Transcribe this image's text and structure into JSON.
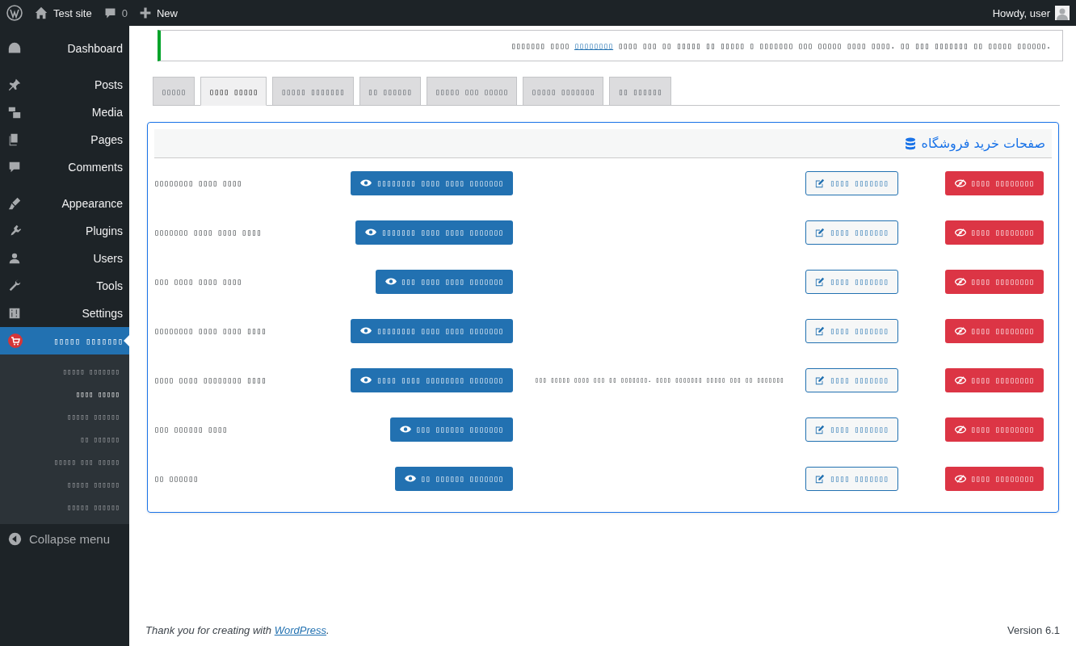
{
  "admin_bar": {
    "site": "Test site",
    "comments": "0",
    "new": "New",
    "greeting": "Howdy, user"
  },
  "sidebar": {
    "items": [
      {
        "label": "Dashboard",
        "selected": false
      },
      {
        "label": "Posts",
        "selected": false
      },
      {
        "label": "Media",
        "selected": false
      },
      {
        "label": "Pages",
        "selected": false
      },
      {
        "label": "Comments",
        "selected": false
      },
      {
        "label": "Appearance",
        "selected": false
      },
      {
        "label": "Plugins",
        "selected": false
      },
      {
        "label": "Users",
        "selected": false
      },
      {
        "label": "Tools",
        "selected": false
      },
      {
        "label": "Settings",
        "selected": false
      },
      {
        "label": "▯▯▯▯▯ ▯▯▯▯▯▯▯",
        "selected": true
      }
    ],
    "submenu": [
      {
        "label": "▯▯▯▯▯ ▯▯▯▯▯▯▯",
        "selected": false
      },
      {
        "label": "▯▯▯▯ ▯▯▯▯▯",
        "selected": true
      },
      {
        "label": "▯▯▯▯▯ ▯▯▯▯▯▯",
        "selected": false
      },
      {
        "label": "▯▯ ▯▯▯▯▯▯",
        "selected": false
      },
      {
        "label": "▯▯▯▯▯ ▯▯▯ ▯▯▯▯▯",
        "selected": false
      },
      {
        "label": "▯▯▯▯▯ ▯▯▯▯▯▯",
        "selected": false
      },
      {
        "label": "▯▯▯▯▯ ▯▯▯▯▯▯",
        "selected": false
      }
    ],
    "collapse": "Collapse menu"
  },
  "notice": {
    "before": "▯▯▯▯▯▯▯ ▯▯▯▯ ",
    "link": "▯▯▯▯▯▯▯▯",
    "after": " ▯▯▯▯ ▯▯▯ ▯▯ ▯▯▯▯▯ ▯▯ ▯▯▯▯▯ ▯ ▯▯▯▯▯▯▯ ▯▯▯ ▯▯▯▯▯ ▯▯▯▯ ▯▯▯▯. ▯▯ ▯▯▯ ▯▯▯▯▯▯▯ ▯▯ ▯▯▯▯▯ ▯▯▯▯▯▯."
  },
  "tabs": [
    {
      "label": "▯▯▯▯▯",
      "selected": false
    },
    {
      "label": "▯▯▯▯ ▯▯▯▯▯",
      "selected": true
    },
    {
      "label": "▯▯▯▯▯ ▯▯▯▯▯▯▯",
      "selected": false
    },
    {
      "label": "▯▯ ▯▯▯▯▯▯",
      "selected": false
    },
    {
      "label": "▯▯▯▯▯ ▯▯▯ ▯▯▯▯▯",
      "selected": false
    },
    {
      "label": "▯▯▯▯▯ ▯▯▯▯▯▯▯",
      "selected": false
    },
    {
      "label": "▯▯ ▯▯▯▯▯▯",
      "selected": false
    }
  ],
  "card": {
    "title": "صفحات خرید فروشگاه",
    "rows": [
      {
        "label": "▯▯▯▯▯▯▯▯ ▯▯▯▯ ▯▯▯▯",
        "view": "▯▯▯▯▯▯▯▯ ▯▯▯▯ ▯▯▯▯ ▯▯▯▯▯▯▯",
        "edit": "▯▯▯▯ ▯▯▯▯▯▯▯",
        "delete": "▯▯▯▯ ▯▯▯▯▯▯▯▯"
      },
      {
        "label": "▯▯▯▯▯▯▯ ▯▯▯▯ ▯▯▯▯ ▯▯▯▯",
        "view": "▯▯▯▯▯▯▯ ▯▯▯▯ ▯▯▯▯ ▯▯▯▯▯▯▯",
        "edit": "▯▯▯▯ ▯▯▯▯▯▯▯",
        "delete": "▯▯▯▯ ▯▯▯▯▯▯▯▯"
      },
      {
        "label": "▯▯▯ ▯▯▯▯ ▯▯▯▯ ▯▯▯▯",
        "view": "▯▯▯ ▯▯▯▯ ▯▯▯▯ ▯▯▯▯▯▯▯",
        "edit": "▯▯▯▯ ▯▯▯▯▯▯▯",
        "delete": "▯▯▯▯ ▯▯▯▯▯▯▯▯"
      },
      {
        "label": "▯▯▯▯▯▯▯▯ ▯▯▯▯ ▯▯▯▯ ▯▯▯▯",
        "view": "▯▯▯▯▯▯▯▯ ▯▯▯▯ ▯▯▯▯ ▯▯▯▯▯▯▯",
        "edit": "▯▯▯▯ ▯▯▯▯▯▯▯",
        "delete": "▯▯▯▯ ▯▯▯▯▯▯▯▯"
      },
      {
        "label": "▯▯▯▯ ▯▯▯▯ ▯▯▯▯▯▯▯▯ ▯▯▯▯",
        "view": "▯▯▯▯ ▯▯▯▯ ▯▯▯▯▯▯▯▯ ▯▯▯▯▯▯▯",
        "note": "▯▯▯ ▯▯▯▯▯ ▯▯▯▯ ▯▯▯ ▯▯ ▯▯▯▯▯▯▯. ▯▯▯▯ ▯▯▯▯▯▯▯ ▯▯▯▯▯ ▯▯▯ ▯▯ ▯▯▯▯▯▯▯",
        "edit": "▯▯▯▯ ▯▯▯▯▯▯▯",
        "delete": "▯▯▯▯ ▯▯▯▯▯▯▯▯"
      },
      {
        "label": "▯▯▯ ▯▯▯▯▯▯ ▯▯▯▯",
        "view": "▯▯▯ ▯▯▯▯▯▯ ▯▯▯▯▯▯▯",
        "edit": "▯▯▯▯ ▯▯▯▯▯▯▯",
        "delete": "▯▯▯▯ ▯▯▯▯▯▯▯▯"
      },
      {
        "label": "▯▯ ▯▯▯▯▯▯",
        "view": "▯▯ ▯▯▯▯▯▯ ▯▯▯▯▯▯▯",
        "edit": "▯▯▯▯ ▯▯▯▯▯▯▯",
        "delete": "▯▯▯▯ ▯▯▯▯▯▯▯▯"
      }
    ]
  },
  "footer": {
    "before": "Thank you for creating with ",
    "link": "WordPress",
    "after": ".",
    "version": "Version 6.1"
  }
}
